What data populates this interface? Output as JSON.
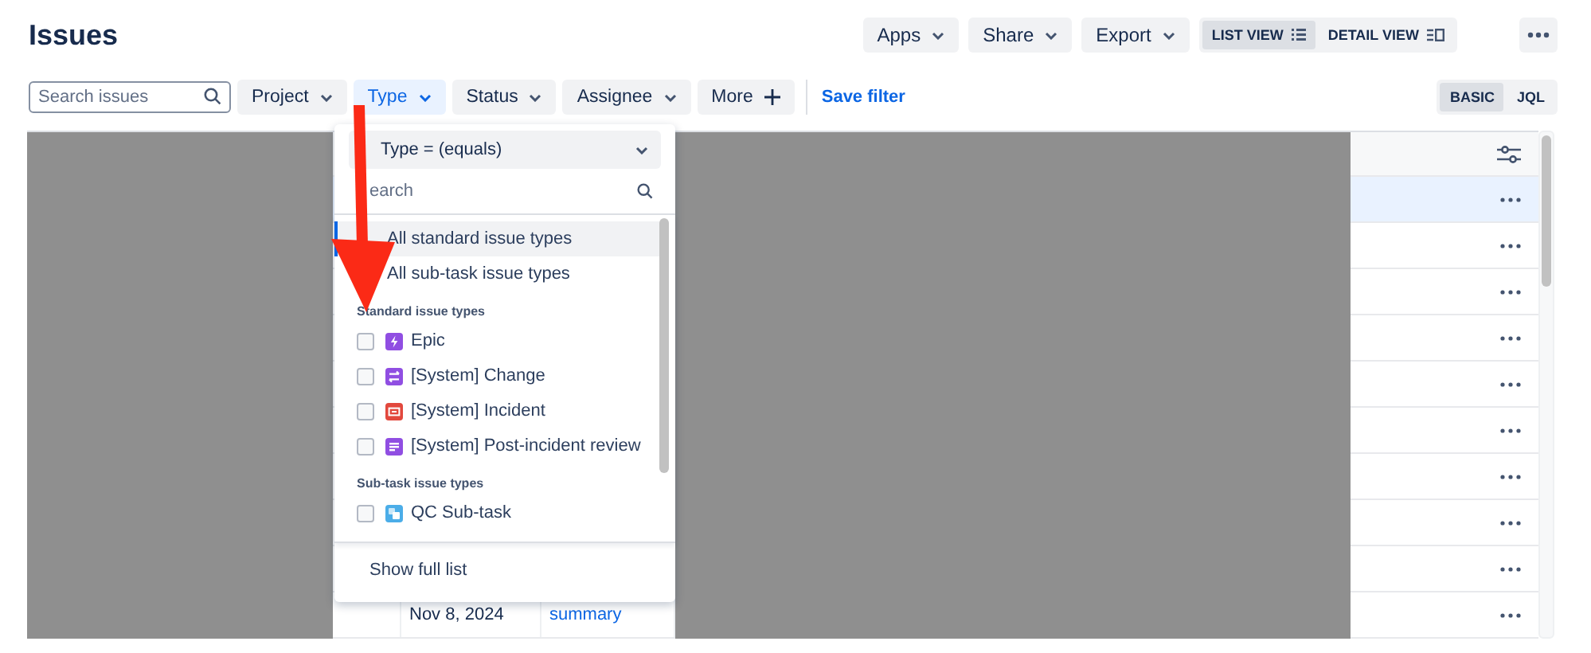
{
  "title": "Issues",
  "header_buttons": [
    {
      "label": "Apps"
    },
    {
      "label": "Share"
    },
    {
      "label": "Export"
    }
  ],
  "view_toggle": [
    {
      "label": "LIST VIEW",
      "kind": "list",
      "selected": true
    },
    {
      "label": "DETAIL VIEW",
      "kind": "detail",
      "selected": false
    }
  ],
  "filter_bar": {
    "search": {
      "placeholder": "Search issues"
    },
    "filters": [
      {
        "label": "Project",
        "active": false
      },
      {
        "label": "Type",
        "active": true
      },
      {
        "label": "Status",
        "active": false
      },
      {
        "label": "Assignee",
        "active": false
      }
    ],
    "more": "More",
    "save_filter": "Save filter",
    "mode": [
      {
        "label": "BASIC",
        "selected": true
      },
      {
        "label": "JQL",
        "selected": false
      }
    ]
  },
  "table": {
    "rows": [
      {
        "selected": true
      },
      {
        "selected": false
      },
      {
        "selected": false
      },
      {
        "selected": false
      },
      {
        "selected": false
      },
      {
        "selected": false
      },
      {
        "selected": false
      },
      {
        "selected": false
      },
      {
        "selected": false
      },
      {
        "selected": false,
        "created": "Nov 8, 2024",
        "summary": "summary"
      }
    ]
  },
  "type_dropdown": {
    "operator": "Type = (equals)",
    "search": {
      "placeholder": "earch"
    },
    "options": [
      {
        "kind": "all",
        "label": "All standard issue types",
        "highlighted": true
      },
      {
        "kind": "all",
        "label": "All sub-task issue types",
        "highlighted": false
      },
      {
        "kind": "heading",
        "label": "Standard issue types"
      },
      {
        "kind": "type",
        "label": "Epic",
        "checked": false,
        "color": "#904ee2"
      },
      {
        "kind": "type",
        "label": "[System] Change",
        "checked": false,
        "color": "#904ee2"
      },
      {
        "kind": "type",
        "label": "[System] Incident",
        "checked": false,
        "color": "#e2483d"
      },
      {
        "kind": "type",
        "label": "[System] Post-incident review",
        "checked": false,
        "color": "#904ee2"
      },
      {
        "kind": "heading",
        "label": "Sub-task issue types"
      },
      {
        "kind": "type",
        "label": "QC Sub-task",
        "checked": false,
        "color": "#4bade8"
      }
    ],
    "footer": "Show full list"
  }
}
